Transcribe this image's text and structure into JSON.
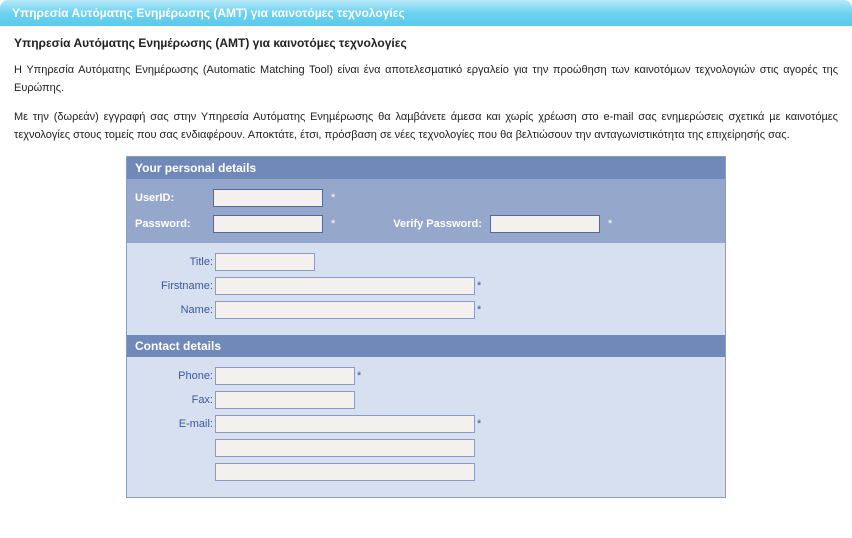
{
  "header": {
    "title": "Υπηρεσία Αυτόµατης Ενηµέρωσης (AMT) για καινοτόµες τεχνολογίες"
  },
  "main": {
    "title": "Υπηρεσία Αυτόµατης Ενηµέρωσης (AMT) για καινοτόµες τεχνολογίες",
    "intro1": "Η Υπηρεσία Αυτόµατης Ενηµέρωσης (Automatic Matching Tool) είναι ένα αποτελεσµατικό εργαλείο για την προώθηση των καινοτόµων τεχνολογιών στις αγορές της Ευρώπης.",
    "intro2": "Με την (δωρεάν) εγγραφή σας στην Υπηρεσία Αυτόµατης Ενηµέρωσης θα λαµβάνετε άµεσα και χωρίς χρέωση στο e-mail σας ενηµερώσεις σχετικά µε καινοτόµες τεχνολογίες στους τοµείς που σας ενδιαφέρουν. Αποκτάτε, έτσι, πρόσβαση σε νέες τεχνολογίες που θα βελτιώσουν την ανταγωνιστικότητα της επιχείρησής σας."
  },
  "sections": {
    "personal_header": "Your personal details",
    "contact_header": "Contact details"
  },
  "labels": {
    "userid": "UserID:",
    "password": "Password:",
    "verify_password": "Verify Password:",
    "title": "Title:",
    "firstname": "Firstname:",
    "name": "Name:",
    "phone": "Phone:",
    "fax": "Fax:",
    "email": "E-mail:"
  },
  "values": {
    "userid": "",
    "password": "",
    "verify_password": "",
    "title": "",
    "firstname": "",
    "name": "",
    "phone": "",
    "fax": "",
    "email": "",
    "email2": "",
    "email3": ""
  },
  "required_marker": "*"
}
